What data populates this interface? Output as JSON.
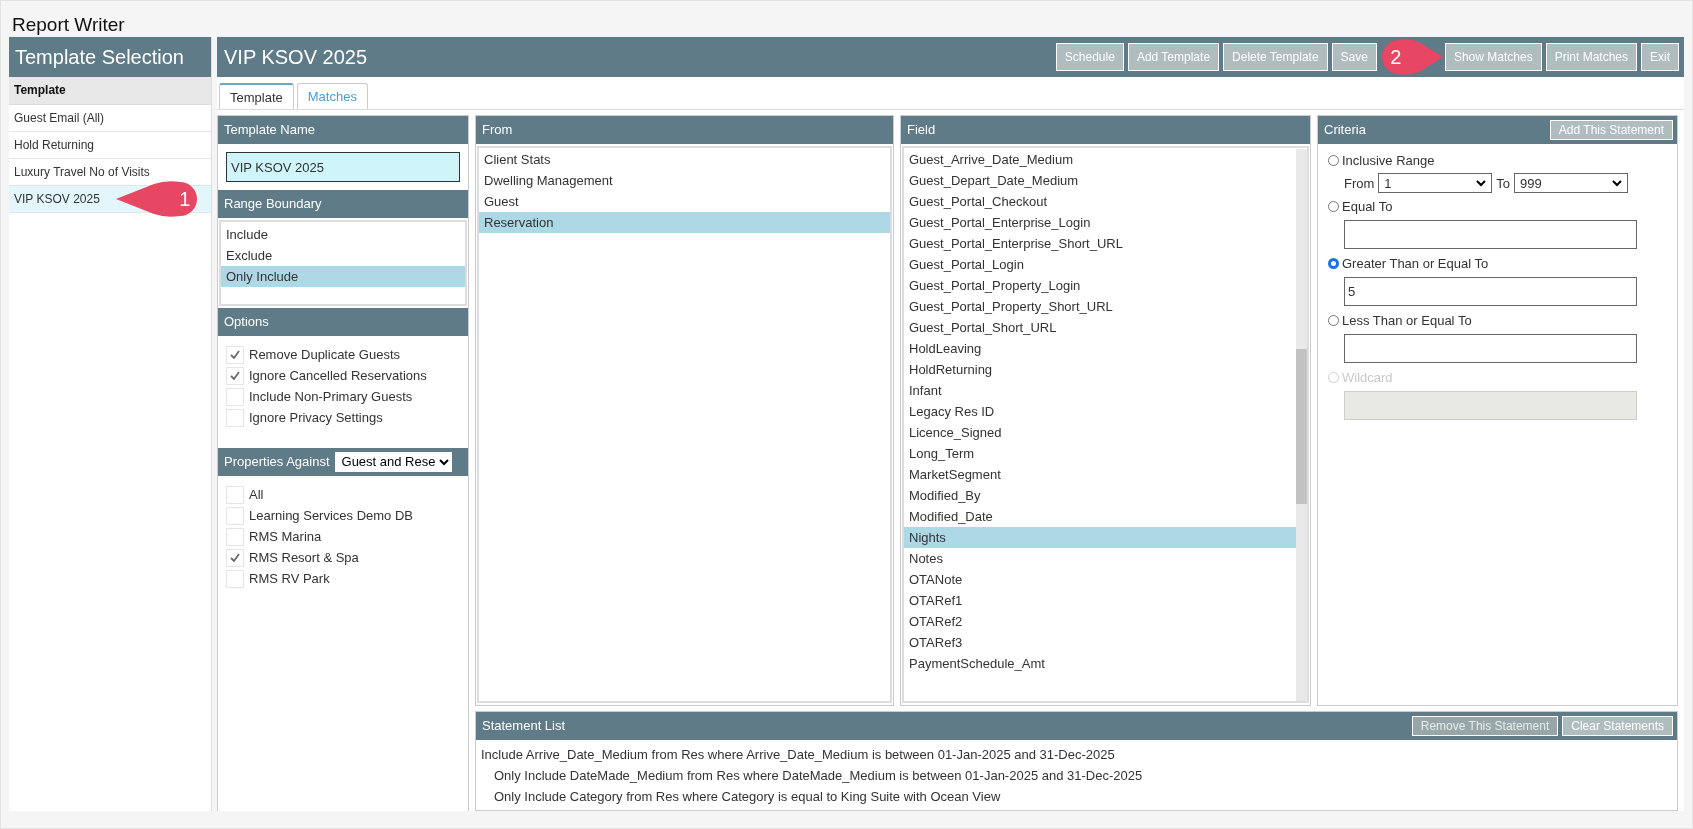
{
  "window": {
    "title": "Report Writer"
  },
  "template_selection": {
    "title": "Template Selection",
    "column": "Template",
    "items": [
      {
        "label": "Guest Email (All)",
        "selected": false
      },
      {
        "label": "Hold Returning",
        "selected": false
      },
      {
        "label": "Luxury Travel No of Visits",
        "selected": false
      },
      {
        "label": "VIP KSOV 2025",
        "selected": true
      }
    ]
  },
  "header": {
    "title": "VIP KSOV 2025",
    "buttons": [
      "Schedule",
      "Add Template",
      "Delete Template",
      "Save",
      "Show Matches",
      "Print Matches",
      "Exit"
    ]
  },
  "tabs": [
    {
      "label": "Template",
      "selected": true
    },
    {
      "label": "Matches",
      "selected": false
    }
  ],
  "template_name": {
    "title": "Template Name",
    "value": "VIP KSOV 2025"
  },
  "range_boundary": {
    "title": "Range Boundary",
    "items": [
      {
        "label": "Include",
        "selected": false
      },
      {
        "label": "Exclude",
        "selected": false
      },
      {
        "label": "Only Include",
        "selected": true
      }
    ]
  },
  "options": {
    "title": "Options",
    "items": [
      {
        "label": "Remove Duplicate Guests",
        "checked": true
      },
      {
        "label": "Ignore Cancelled Reservations",
        "checked": true
      },
      {
        "label": "Include Non-Primary Guests",
        "checked": false
      },
      {
        "label": "Ignore Privacy Settings",
        "checked": false
      }
    ]
  },
  "properties": {
    "title": "Properties Against",
    "select": "Guest and Rese",
    "items": [
      {
        "label": "All",
        "checked": false
      },
      {
        "label": "Learning Services Demo DB",
        "checked": false
      },
      {
        "label": "RMS Marina",
        "checked": false
      },
      {
        "label": "RMS Resort & Spa",
        "checked": true
      },
      {
        "label": "RMS RV Park",
        "checked": false
      }
    ]
  },
  "from": {
    "title": "From",
    "items": [
      {
        "label": "Client Stats",
        "selected": false
      },
      {
        "label": "Dwelling Management",
        "selected": false
      },
      {
        "label": "Guest",
        "selected": false
      },
      {
        "label": "Reservation",
        "selected": true
      }
    ]
  },
  "field": {
    "title": "Field",
    "items": [
      {
        "label": "Guest_Arrive_Date_Medium",
        "selected": false
      },
      {
        "label": "Guest_Depart_Date_Medium",
        "selected": false
      },
      {
        "label": "Guest_Portal_Checkout",
        "selected": false
      },
      {
        "label": "Guest_Portal_Enterprise_Login",
        "selected": false
      },
      {
        "label": "Guest_Portal_Enterprise_Short_URL",
        "selected": false
      },
      {
        "label": "Guest_Portal_Login",
        "selected": false
      },
      {
        "label": "Guest_Portal_Property_Login",
        "selected": false
      },
      {
        "label": "Guest_Portal_Property_Short_URL",
        "selected": false
      },
      {
        "label": "Guest_Portal_Short_URL",
        "selected": false
      },
      {
        "label": "HoldLeaving",
        "selected": false
      },
      {
        "label": "HoldReturning",
        "selected": false
      },
      {
        "label": "Infant",
        "selected": false
      },
      {
        "label": "Legacy Res ID",
        "selected": false
      },
      {
        "label": "Licence_Signed",
        "selected": false
      },
      {
        "label": "Long_Term",
        "selected": false
      },
      {
        "label": "MarketSegment",
        "selected": false
      },
      {
        "label": "Modified_By",
        "selected": false
      },
      {
        "label": "Modified_Date",
        "selected": false
      },
      {
        "label": "Nights",
        "selected": true
      },
      {
        "label": "Notes",
        "selected": false
      },
      {
        "label": "OTANote",
        "selected": false
      },
      {
        "label": "OTARef1",
        "selected": false
      },
      {
        "label": "OTARef2",
        "selected": false
      },
      {
        "label": "OTARef3",
        "selected": false
      },
      {
        "label": "PaymentSchedule_Amt",
        "selected": false
      }
    ]
  },
  "criteria": {
    "title": "Criteria",
    "button": "Add This Statement",
    "choices": [
      {
        "kind": "range",
        "label": "Inclusive Range",
        "selected": false,
        "disabled": false,
        "from_label": "From",
        "from": "1",
        "to_label": "To",
        "to": "999"
      },
      {
        "kind": "text",
        "label": "Equal To",
        "selected": false,
        "disabled": false
      },
      {
        "kind": "text",
        "label": "Greater Than or Equal To",
        "selected": true,
        "disabled": false,
        "value": "5"
      },
      {
        "kind": "text",
        "label": "Less Than or Equal To",
        "selected": false,
        "disabled": false
      },
      {
        "kind": "text",
        "label": "Wildcard",
        "selected": false,
        "disabled": true
      }
    ]
  },
  "statement_list": {
    "title": "Statement List",
    "buttons": [
      {
        "label": "Remove This Statement",
        "disabled": true
      },
      {
        "label": "Clear Statements",
        "disabled": false
      }
    ],
    "statements": [
      {
        "text": "Include Arrive_Date_Medium from Res where Arrive_Date_Medium is between 01-Jan-2025 and 31-Dec-2025",
        "children": [
          {
            "text": "Only Include DateMade_Medium from Res where DateMade_Medium is between 01-Jan-2025 and 31-Dec-2025"
          },
          {
            "text": "Only Include Category from Res where Category is equal to King Suite with Ocean View"
          }
        ]
      }
    ]
  },
  "callouts": [
    "1",
    "2"
  ]
}
